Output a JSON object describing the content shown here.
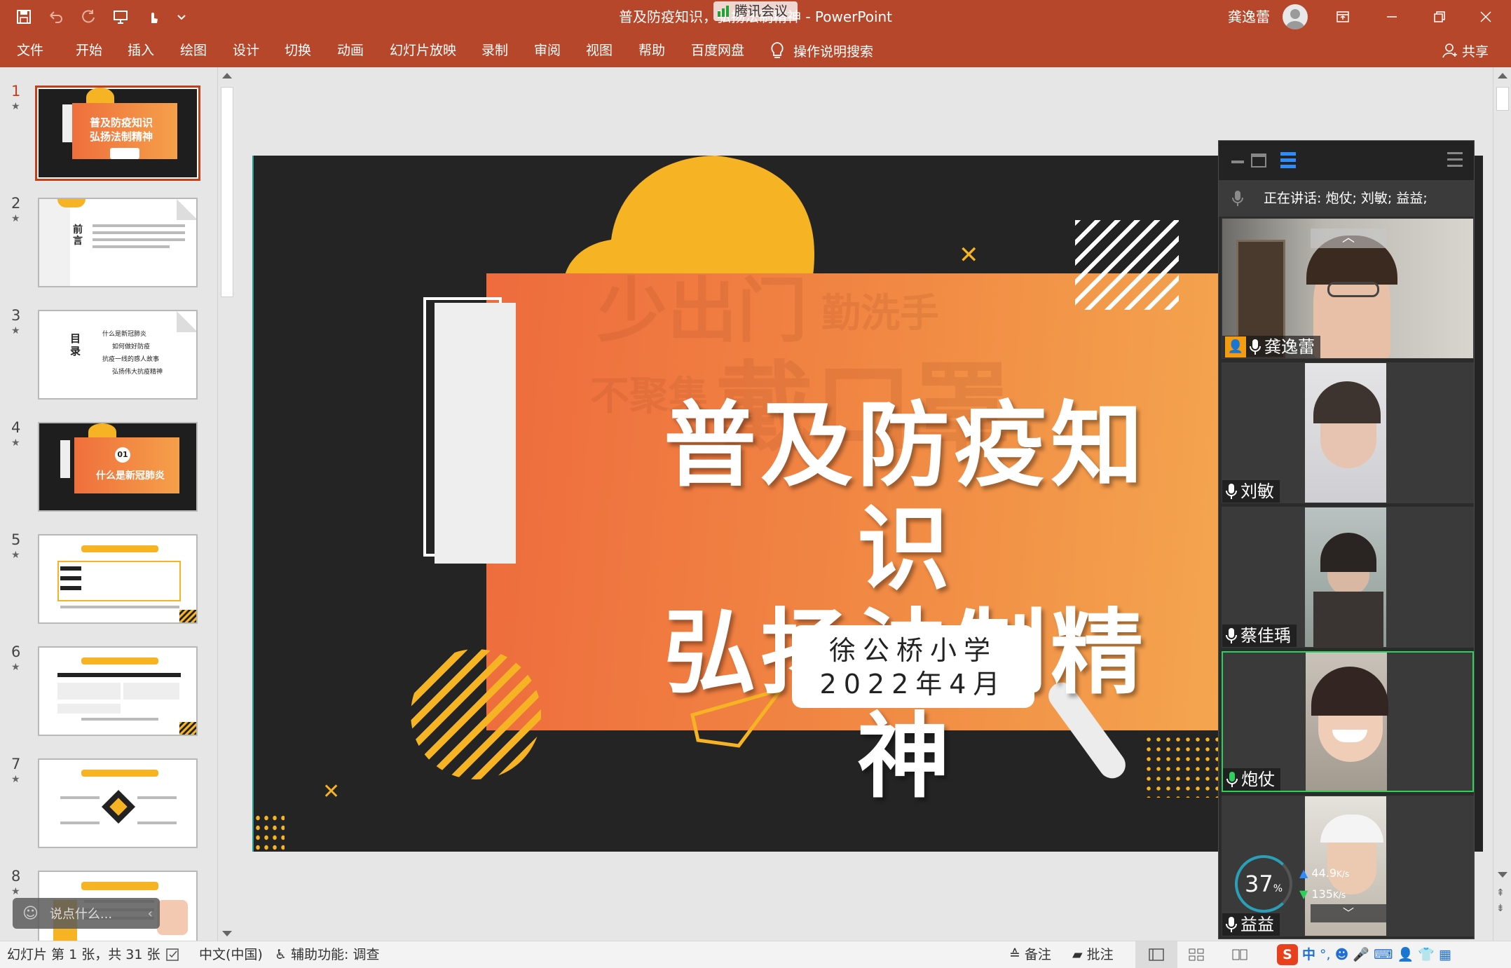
{
  "window": {
    "doc_title": "普及防疫知识，弘扬法制精神 - PowerPoint",
    "meeting_pill": "腾讯会议",
    "user_name": "龚逸蕾"
  },
  "ribbon": {
    "tabs": [
      "文件",
      "开始",
      "插入",
      "绘图",
      "设计",
      "切换",
      "动画",
      "幻灯片放映",
      "录制",
      "审阅",
      "视图",
      "帮助",
      "百度网盘"
    ],
    "tell_me": "操作说明搜索",
    "share": "共享"
  },
  "thumbnails": {
    "numbers": [
      "1",
      "2",
      "3",
      "4",
      "5",
      "6",
      "7",
      "8"
    ],
    "slide2_label": "前言",
    "slide3_label": "目录",
    "slide3_items": [
      "什么是新冠肺炎",
      "如何做好防疫",
      "抗疫一线的感人故事",
      "弘扬伟大抗疫精神"
    ],
    "slide4_num": "01",
    "slide4_title": "什么是新冠肺炎",
    "comment_placeholder": "说点什么..."
  },
  "slide": {
    "title_line1": "普及防疫知识",
    "title_line2": "弘扬法制精神",
    "school": "徐公桥小学",
    "date": "2022年4月",
    "watermark1": "少出门",
    "watermark2": "勤洗手",
    "watermark3": "不聚集",
    "watermark4": "戴口罩"
  },
  "meeting": {
    "speaking": "正在讲话: 炮仗; 刘敏; 益益;",
    "participants": [
      {
        "name": "龚逸蕾"
      },
      {
        "name": "刘敏"
      },
      {
        "name": "蔡佳瑀"
      },
      {
        "name": "炮仗"
      },
      {
        "name": "益益"
      }
    ],
    "net_percent": "37",
    "net_percent_unit": "%",
    "upload": "44.9",
    "download": "135",
    "rate_unit": "K/s"
  },
  "statusbar": {
    "slide_info": "幻灯片 第 1 张，共 31 张",
    "language": "中文(中国)",
    "accessibility": "辅助功能: 调查",
    "notes": "备注",
    "comments": "批注",
    "ime": "中"
  },
  "colors": {
    "accent": "#b7472a",
    "slide_bg": "#242424",
    "orange": "#f07a3c",
    "yellow": "#f6b324",
    "speaker_green": "#2fcf5f"
  }
}
